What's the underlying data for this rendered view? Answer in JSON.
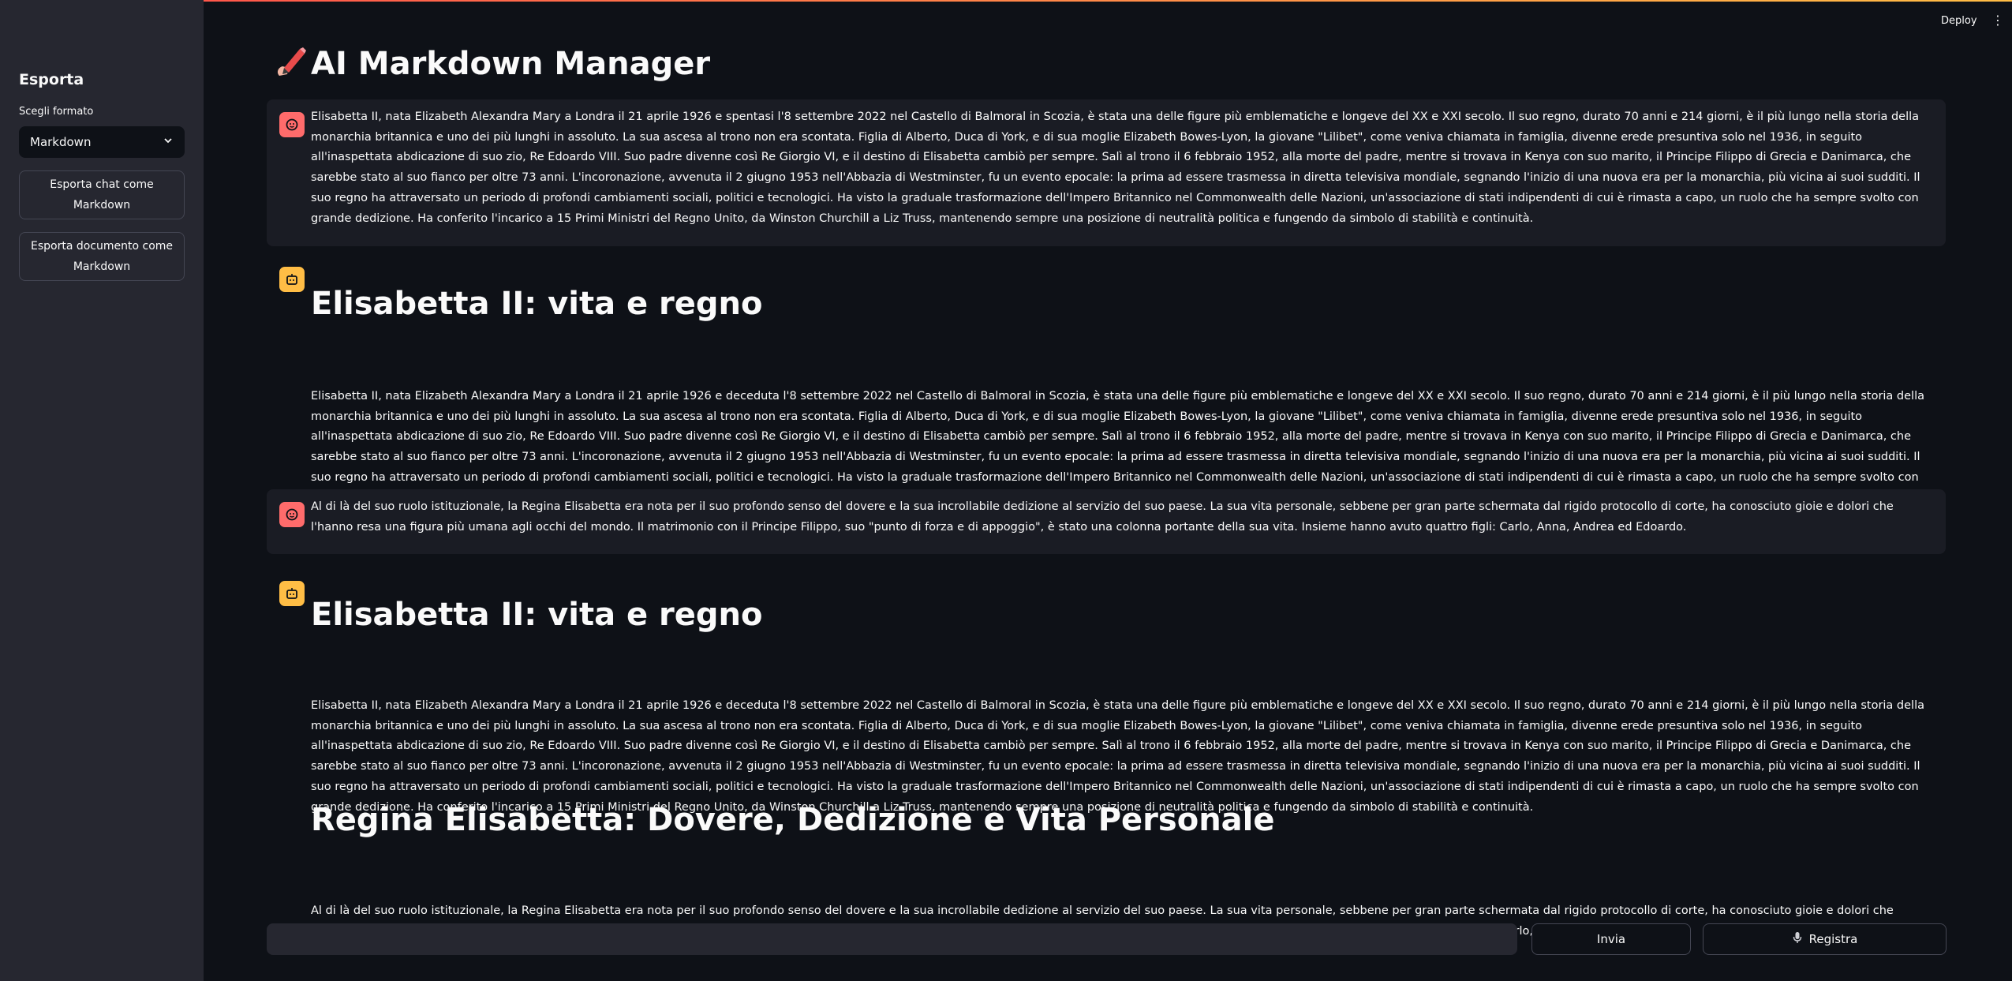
{
  "app": {
    "deploy_label": "Deploy",
    "title": "AI Markdown Manager"
  },
  "sidebar": {
    "title": "Esporta",
    "format_label": "Scegli formato",
    "format_selected": "Markdown",
    "export_chat_label": "Esporta chat come Markdown",
    "export_doc_label": "Esporta documento come Markdown"
  },
  "messages": [
    {
      "role": "user",
      "text": "Elisabetta II, nata Elizabeth Alexandra Mary a Londra il 21 aprile 1926 e spentasi l'8 settembre 2022 nel Castello di Balmoral in Scozia, è stata una delle figure più emblematiche e longeve del XX e XXI secolo. Il suo regno, durato 70 anni e 214 giorni, è il più lungo nella storia della monarchia britannica e uno dei più lunghi in assoluto. La sua ascesa al trono non era scontata. Figlia di Alberto, Duca di York, e di sua moglie Elizabeth Bowes-Lyon, la giovane \"Lilibet\", come veniva chiamata in famiglia, divenne erede presuntiva solo nel 1936, in seguito all'inaspettata abdicazione di suo zio, Re Edoardo VIII. Suo padre divenne così Re Giorgio VI, e il destino di Elisabetta cambiò per sempre. Salì al trono il 6 febbraio 1952, alla morte del padre, mentre si trovava in Kenya con suo marito, il Principe Filippo di Grecia e Danimarca, che sarebbe stato al suo fianco per oltre 73 anni. L'incoronazione, avvenuta il 2 giugno 1953 nell'Abbazia di Westminster, fu un evento epocale: la prima ad essere trasmessa in diretta televisiva mondiale, segnando l'inizio di una nuova era per la monarchia, più vicina ai suoi sudditi. Il suo regno ha attraversato un periodo di profondi cambiamenti sociali, politici e tecnologici. Ha visto la graduale trasformazione dell'Impero Britannico nel Commonwealth delle Nazioni, un'associazione di stati indipendenti di cui è rimasta a capo, un ruolo che ha sempre svolto con grande dedizione. Ha conferito l'incarico a 15 Primi Ministri del Regno Unito, da Winston Churchill a Liz Truss, mantenendo sempre una posizione di neutralità politica e fungendo da simbolo di stabilità e continuità."
    },
    {
      "role": "assistant",
      "heading": "Elisabetta II: vita e regno",
      "text": "Elisabetta II, nata Elizabeth Alexandra Mary a Londra il 21 aprile 1926 e deceduta l'8 settembre 2022 nel Castello di Balmoral in Scozia, è stata una delle figure più emblematiche e longeve del XX e XXI secolo. Il suo regno, durato 70 anni e 214 giorni, è il più lungo nella storia della monarchia britannica e uno dei più lunghi in assoluto. La sua ascesa al trono non era scontata. Figlia di Alberto, Duca di York, e di sua moglie Elizabeth Bowes-Lyon, la giovane \"Lilibet\", come veniva chiamata in famiglia, divenne erede presuntiva solo nel 1936, in seguito all'inaspettata abdicazione di suo zio, Re Edoardo VIII. Suo padre divenne così Re Giorgio VI, e il destino di Elisabetta cambiò per sempre. Salì al trono il 6 febbraio 1952, alla morte del padre, mentre si trovava in Kenya con suo marito, il Principe Filippo di Grecia e Danimarca, che sarebbe stato al suo fianco per oltre 73 anni. L'incoronazione, avvenuta il 2 giugno 1953 nell'Abbazia di Westminster, fu un evento epocale: la prima ad essere trasmessa in diretta televisiva mondiale, segnando l'inizio di una nuova era per la monarchia, più vicina ai suoi sudditi. Il suo regno ha attraversato un periodo di profondi cambiamenti sociali, politici e tecnologici. Ha visto la graduale trasformazione dell'Impero Britannico nel Commonwealth delle Nazioni, un'associazione di stati indipendenti di cui è rimasta a capo, un ruolo che ha sempre svolto con grande dedizione. Ha conferito l'incarico a 15 Primi Ministri del Regno Unito, da Winston Churchill a Liz Truss, mantenendo sempre una posizione di neutralità politica e fungendo da simbolo di stabilità e continuità."
    },
    {
      "role": "user",
      "text": "Al di là del suo ruolo istituzionale, la Regina Elisabetta era nota per il suo profondo senso del dovere e la sua incrollabile dedizione al servizio del suo paese. La sua vita personale, sebbene per gran parte schermata dal rigido protocollo di corte, ha conosciuto gioie e dolori che l'hanno resa una figura più umana agli occhi del mondo. Il matrimonio con il Principe Filippo, suo \"punto di forza e di appoggio\", è stato una colonna portante della sua vita. Insieme hanno avuto quattro figli: Carlo, Anna, Andrea ed Edoardo."
    },
    {
      "role": "assistant",
      "heading": "Elisabetta II: vita e regno",
      "text": "Elisabetta II, nata Elizabeth Alexandra Mary a Londra il 21 aprile 1926 e deceduta l'8 settembre 2022 nel Castello di Balmoral in Scozia, è stata una delle figure più emblematiche e longeve del XX e XXI secolo. Il suo regno, durato 70 anni e 214 giorni, è il più lungo nella storia della monarchia britannica e uno dei più lunghi in assoluto. La sua ascesa al trono non era scontata. Figlia di Alberto, Duca di York, e di sua moglie Elizabeth Bowes-Lyon, la giovane \"Lilibet\", come veniva chiamata in famiglia, divenne erede presuntiva solo nel 1936, in seguito all'inaspettata abdicazione di suo zio, Re Edoardo VIII. Suo padre divenne così Re Giorgio VI, e il destino di Elisabetta cambiò per sempre. Salì al trono il 6 febbraio 1952, alla morte del padre, mentre si trovava in Kenya con suo marito, il Principe Filippo di Grecia e Danimarca, che sarebbe stato al suo fianco per oltre 73 anni. L'incoronazione, avvenuta il 2 giugno 1953 nell'Abbazia di Westminster, fu un evento epocale: la prima ad essere trasmessa in diretta televisiva mondiale, segnando l'inizio di una nuova era per la monarchia, più vicina ai suoi sudditi. Il suo regno ha attraversato un periodo di profondi cambiamenti sociali, politici e tecnologici. Ha visto la graduale trasformazione dell'Impero Britannico nel Commonwealth delle Nazioni, un'associazione di stati indipendenti di cui è rimasta a capo, un ruolo che ha sempre svolto con grande dedizione. Ha conferito l'incarico a 15 Primi Ministri del Regno Unito, da Winston Churchill a Liz Truss, mantenendo sempre una posizione di neutralità politica e fungendo da simbolo di stabilità e continuità.",
      "heading2": "Regina Elisabetta: Dovere, Dedizione e Vita Personale",
      "text2": "Al di là del suo ruolo istituzionale, la Regina Elisabetta era nota per il suo profondo senso del dovere e la sua incrollabile dedizione al servizio del suo paese. La sua vita personale, sebbene per gran parte schermata dal rigido protocollo di corte, ha conosciuto gioie e dolori che l'hanno resa una figura più umana agli occhi del mondo. Il matrimonio con il Principe Filippo, suo \"punto di forza e di appoggio\", è stato una colonna portante della sua vita. Insieme hanno avuto quattro figli: Carlo, Anna, Andrea ed Edoardo."
    }
  ],
  "chat_input": {
    "value": "",
    "placeholder": ""
  },
  "buttons": {
    "send_label": "Invia",
    "record_label": "Registra"
  },
  "colors": {
    "accent_red": "#ff4b4b",
    "accent_yellow": "#ffbd45",
    "background": "#0e1117",
    "sidebar": "#262730"
  }
}
